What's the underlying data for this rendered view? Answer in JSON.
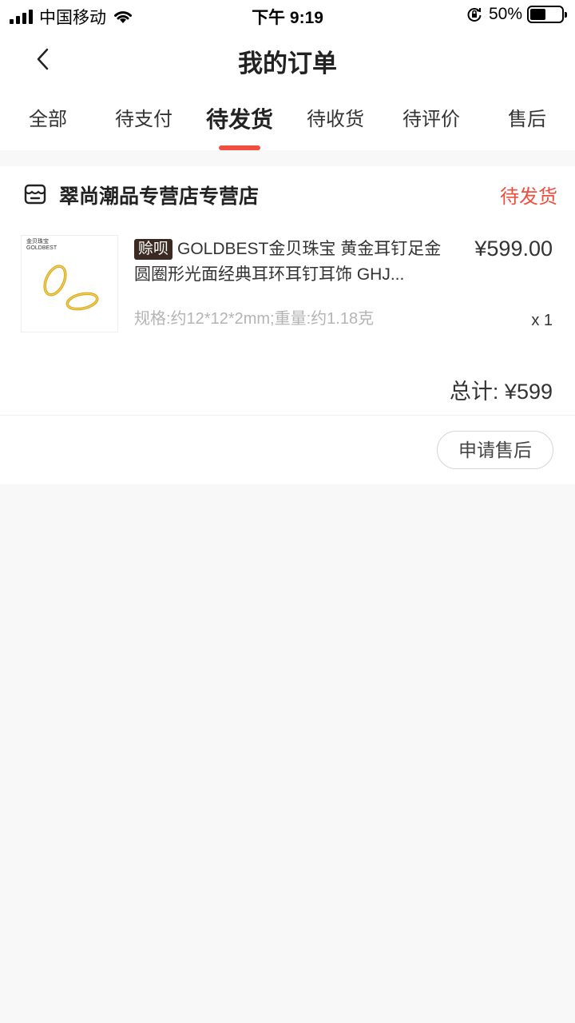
{
  "status_bar": {
    "carrier": "中国移动",
    "time": "下午 9:19",
    "battery": "50%",
    "battery_level": 0.5
  },
  "nav": {
    "title": "我的订单"
  },
  "tabs": [
    {
      "label": "全部"
    },
    {
      "label": "待支付"
    },
    {
      "label": "待发货",
      "active": true
    },
    {
      "label": "待收货"
    },
    {
      "label": "待评价"
    },
    {
      "label": "售后"
    }
  ],
  "order": {
    "shop_name": "翠尚潮品专营店专营店",
    "status": "待发货",
    "product": {
      "badge": "赊呗",
      "title": "GOLDBEST金贝珠宝 黄金耳钉足金圆圈形光面经典耳环耳钉耳饰 GHJ...",
      "thumb_brand_cn": "金贝珠宝",
      "thumb_brand_en": "GOLDBEST",
      "price": "¥599.00",
      "spec": "规格:约12*12*2mm;重量:约1.18克",
      "qty": "x 1"
    },
    "total": "总计: ¥599",
    "after_sale_button": "申请售后"
  },
  "colors": {
    "accent": "#f04e3e",
    "badge_bg": "#3a2a22",
    "page_bg": "#f8f8f8"
  },
  "icons": {
    "back": "chevron-left-icon",
    "shop": "shop-icon",
    "wifi": "wifi-icon",
    "rotation_lock": "rotation-lock-icon",
    "battery": "battery-icon",
    "signal": "signal-icon"
  }
}
